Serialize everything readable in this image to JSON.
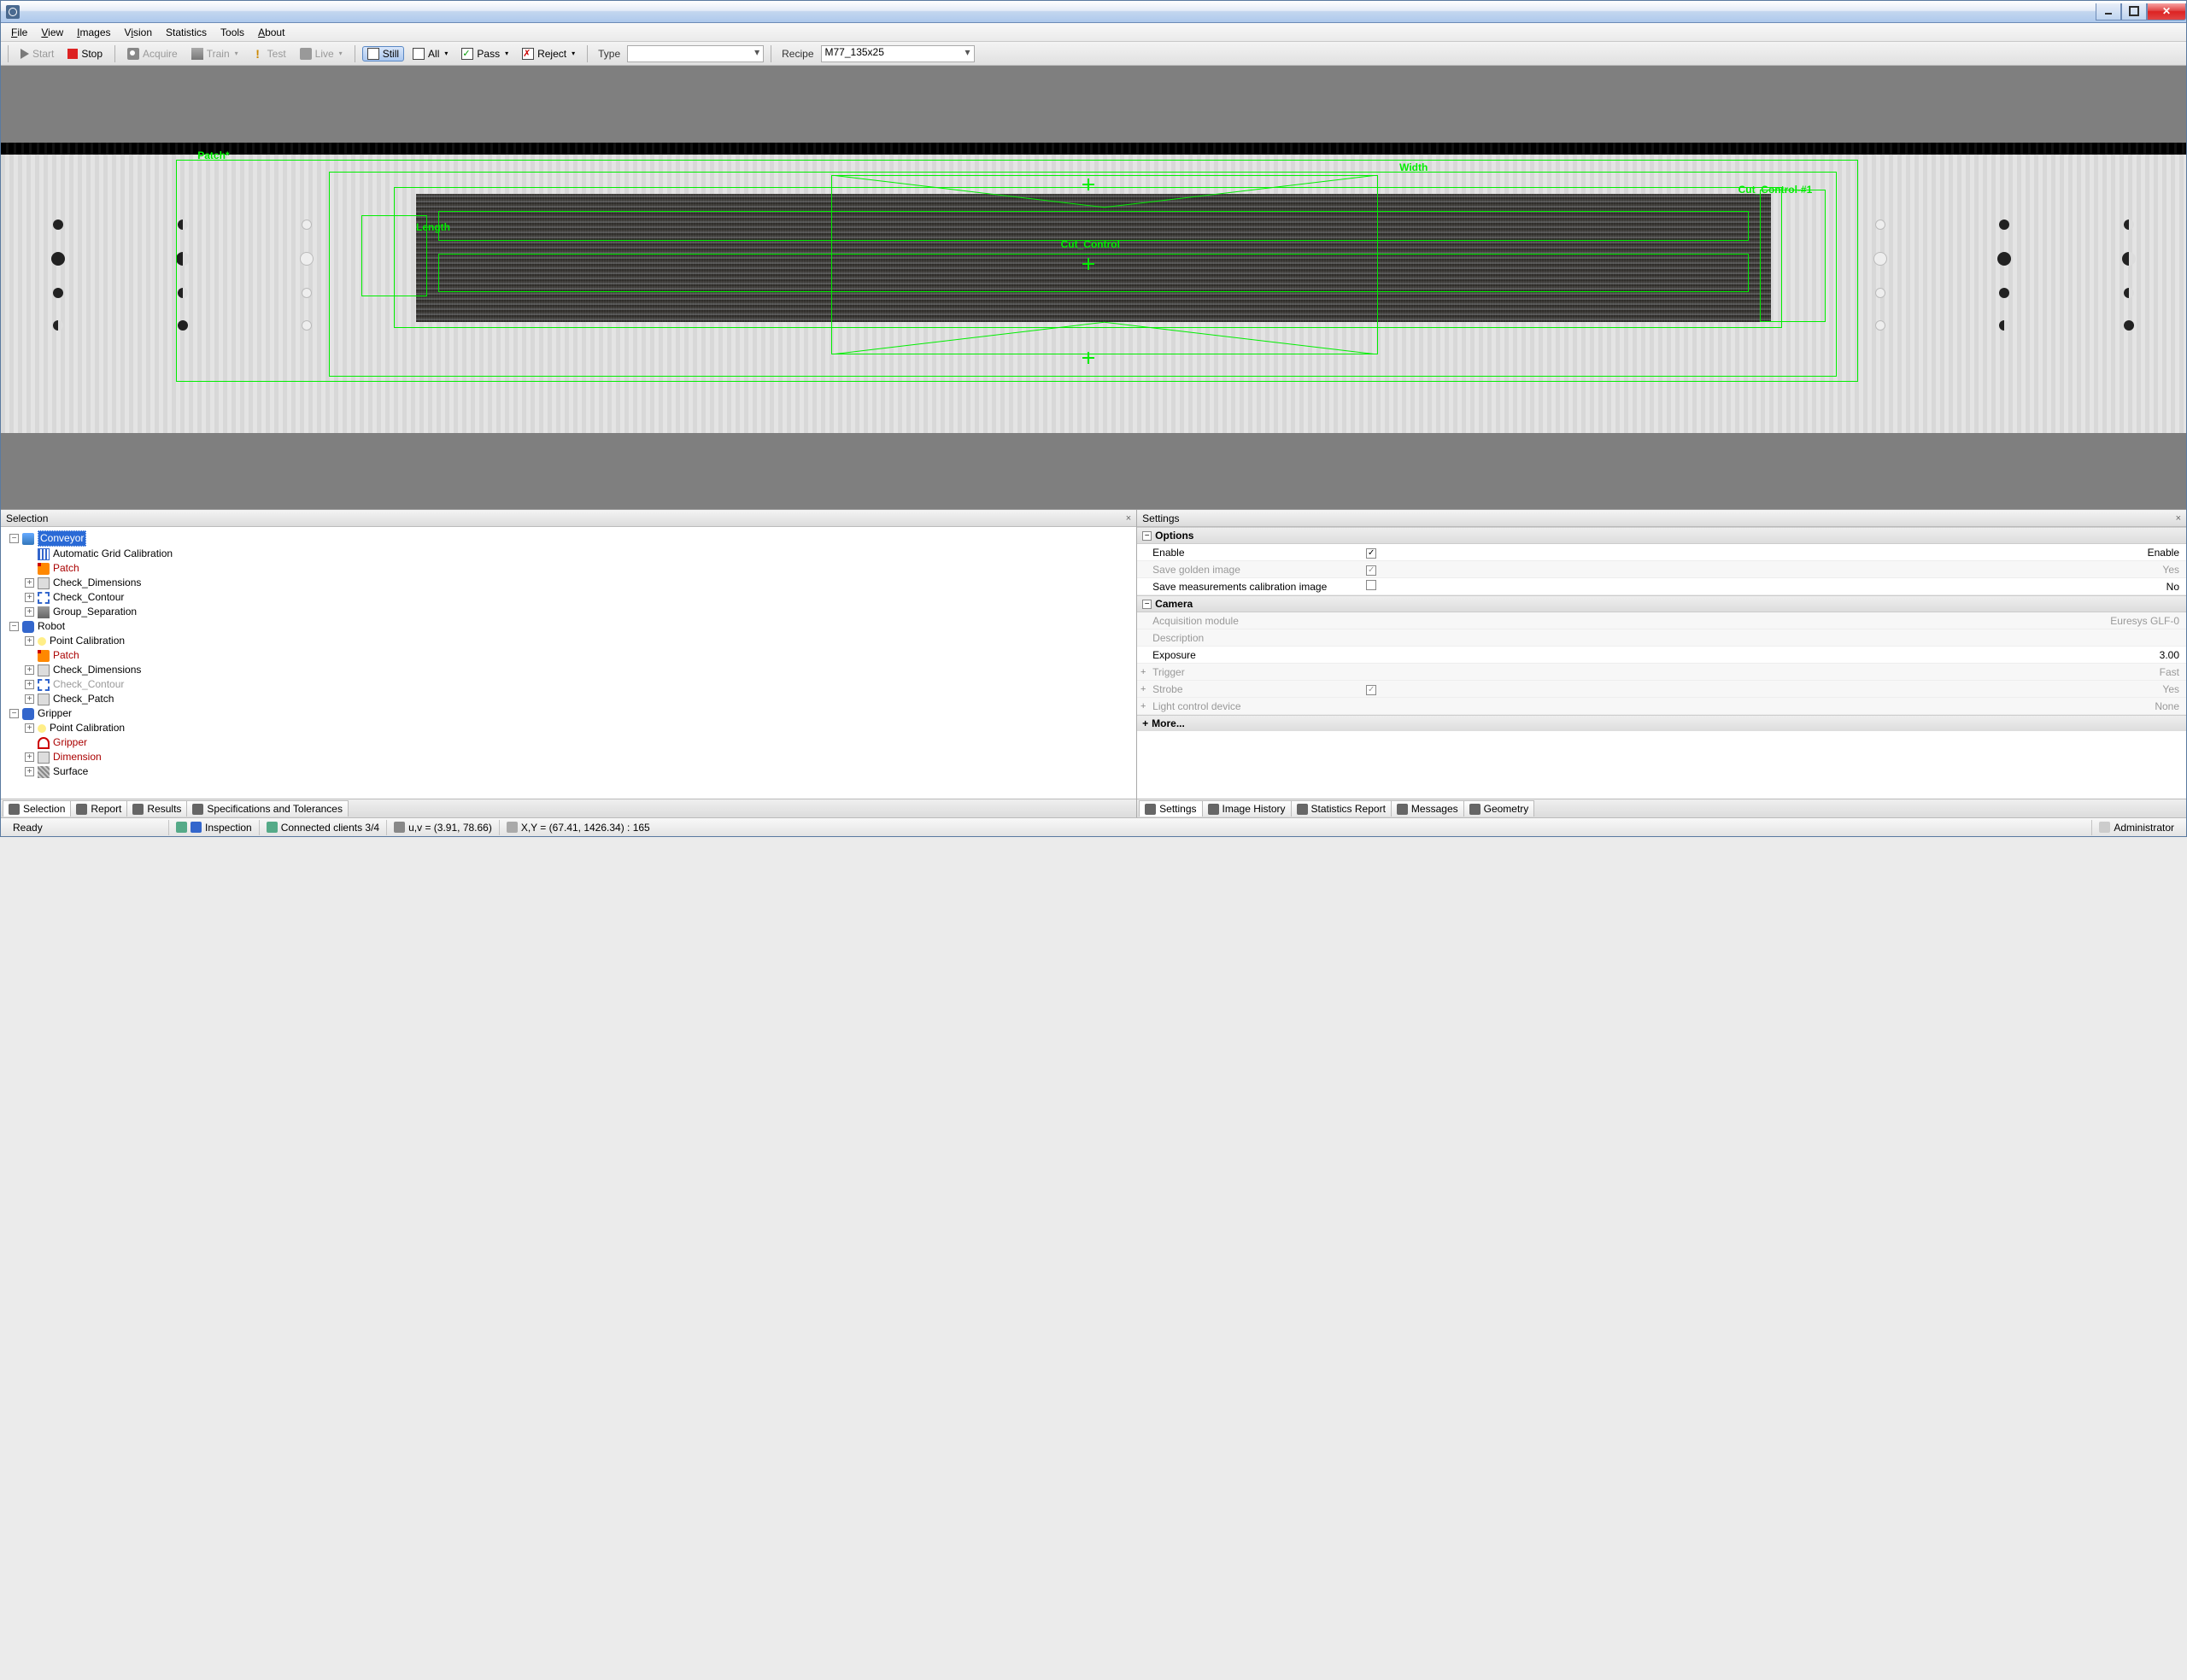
{
  "window": {
    "title": ""
  },
  "menus": {
    "file": "File",
    "view": "View",
    "images": "Images",
    "vision": "Vision",
    "statistics": "Statistics",
    "tools": "Tools",
    "about": "About"
  },
  "toolbar": {
    "start": "Start",
    "stop": "Stop",
    "acquire": "Acquire",
    "train": "Train",
    "test": "Test",
    "live": "Live",
    "still": "Still",
    "all": "All",
    "pass": "Pass",
    "reject": "Reject",
    "type_label": "Type",
    "type_value": "",
    "recipe_label": "Recipe",
    "recipe_value": "M77_135x25"
  },
  "overlay": {
    "patch": "Patch*",
    "width": "Width",
    "length": "Length",
    "cutcontrol": "Cut_Control",
    "cutcontrol_n": "Cut_Control-#1"
  },
  "panes": {
    "selection_title": "Selection",
    "settings_title": "Settings"
  },
  "tree": {
    "root1": "Conveyor",
    "agc": "Automatic Grid Calibration",
    "patch": "Patch",
    "checkdim": "Check_Dimensions",
    "checkcontour": "Check_Contour",
    "groupsep": "Group_Separation",
    "root2": "Robot",
    "ptcal": "Point Calibration",
    "checkdim2": "Check_Dimensions",
    "checkcontour2": "Check_Contour",
    "checkpatch": "Check_Patch",
    "root3": "Gripper",
    "ptcal2": "Point Calibration",
    "gripper": "Gripper",
    "dimension": "Dimension",
    "surface": "Surface"
  },
  "settings": {
    "options": "Options",
    "enable": "Enable",
    "enable_v": "Enable",
    "save_golden": "Save golden image",
    "save_golden_v": "Yes",
    "save_meas": "Save measurements calibration image",
    "save_meas_v": "No",
    "camera": "Camera",
    "acq": "Acquisition module",
    "acq_v": "Euresys GLF-0",
    "desc": "Description",
    "desc_v": "",
    "exposure": "Exposure",
    "exposure_v": "3.00",
    "trigger": "Trigger",
    "trigger_v": "Fast",
    "strobe": "Strobe",
    "strobe_v": "Yes",
    "light": "Light control device",
    "light_v": "None",
    "more": "More..."
  },
  "left_tabs": {
    "sel": "Selection",
    "report": "Report",
    "results": "Results",
    "spec": "Specifications and Tolerances"
  },
  "right_tabs": {
    "settings": "Settings",
    "imghist": "Image History",
    "statsrep": "Statistics Report",
    "messages": "Messages",
    "geom": "Geometry"
  },
  "status": {
    "ready": "Ready",
    "inspection": "Inspection",
    "clients": "Connected clients 3/4",
    "uv": "u,v = (3.91, 78.66)",
    "xy": "X,Y = (67.41, 1426.34) : 165",
    "user": "Administrator"
  }
}
